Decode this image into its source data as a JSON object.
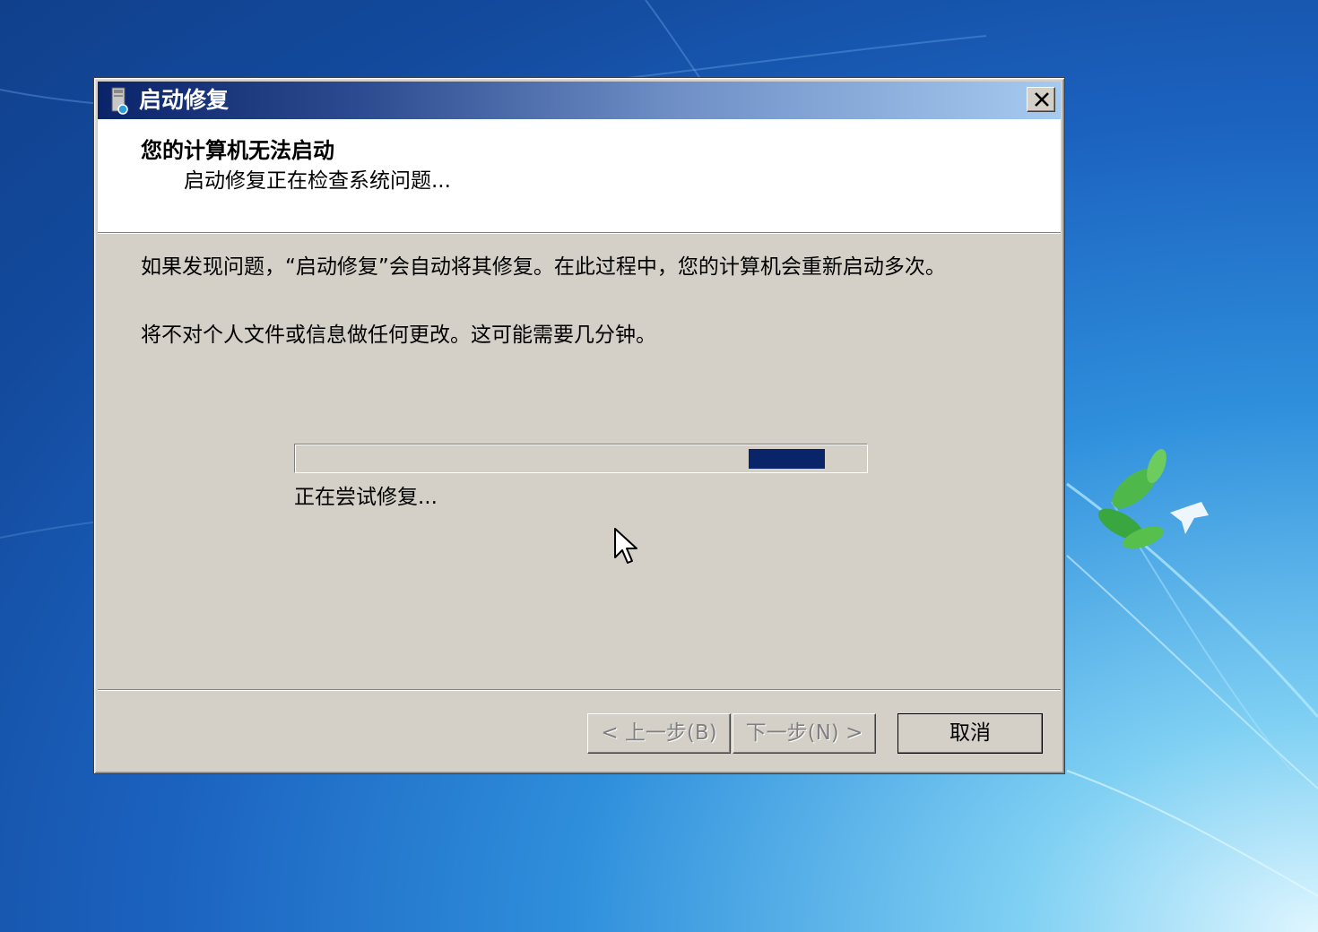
{
  "dialog": {
    "title": "启动修复",
    "icon": "startup-repair-icon",
    "close_icon": "close-icon",
    "header_title": "您的计算机无法启动",
    "header_subtitle": "启动修复正在检查系统问题...",
    "body_text_1": "如果发现问题，“启动修复”会自动将其修复。在此过程中，您的计算机会重新启动多次。",
    "body_text_2": "将不对个人文件或信息做任何更改。这可能需要几分钟。",
    "progress": {
      "mode": "marquee",
      "label": "正在尝试修复..."
    },
    "buttons": {
      "back": "< 上一步(B)",
      "next": "下一步(N) >",
      "cancel": "取消"
    }
  },
  "colors": {
    "titlebar_start": "#0a246a",
    "titlebar_end": "#a6caf0",
    "dialog_face": "#d4d0c8",
    "progress_fill": "#0a246a"
  }
}
